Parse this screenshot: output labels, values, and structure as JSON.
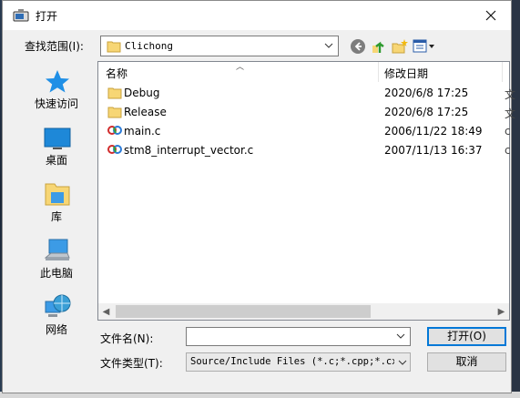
{
  "window": {
    "title": "打开"
  },
  "look_in": {
    "label": "查找范围(I):",
    "value": "Clichong"
  },
  "toolbar": [
    "back-icon",
    "up-folder-icon",
    "new-folder-icon",
    "view-menu-icon"
  ],
  "places": [
    {
      "label": "快速访问",
      "icon": "quick-access-star-icon"
    },
    {
      "label": "桌面",
      "icon": "desktop-icon"
    },
    {
      "label": "库",
      "icon": "libraries-icon"
    },
    {
      "label": "此电脑",
      "icon": "this-pc-icon"
    },
    {
      "label": "网络",
      "icon": "network-icon"
    }
  ],
  "file_list": {
    "columns": [
      "名称",
      "修改日期"
    ],
    "rows": [
      {
        "name": "Debug",
        "date": "2020/6/8 17:25",
        "type": "folder",
        "cut": "文"
      },
      {
        "name": "Release",
        "date": "2020/6/8 17:25",
        "type": "folder",
        "cut": "文"
      },
      {
        "name": "main.c",
        "date": "2006/11/22 18:49",
        "type": "c-source",
        "cut": "c"
      },
      {
        "name": "stm8_interrupt_vector.c",
        "date": "2007/11/13 16:37",
        "type": "c-source",
        "cut": "c"
      }
    ]
  },
  "file_name": {
    "label": "文件名(N):",
    "value": ""
  },
  "file_type": {
    "label": "文件类型(T):",
    "value": "Source/Include Files (*.c;*.cpp;*.cxx"
  },
  "buttons": {
    "open": "打开(O)",
    "cancel": "取消"
  },
  "colors": {
    "accent": "#0078d7",
    "folder": "#f7d675",
    "desktop": "#1e88d8"
  }
}
